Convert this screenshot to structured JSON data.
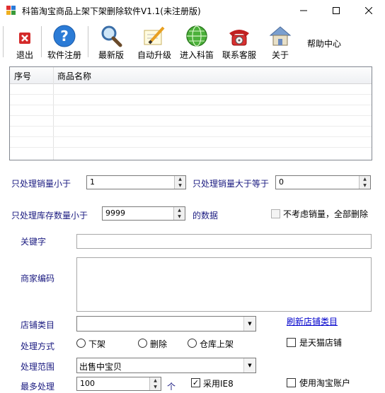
{
  "window": {
    "title": "科笛淘宝商品上架下架删除软件V1.1(未注册版)"
  },
  "toolbar": {
    "items": [
      {
        "label": "退出",
        "icon": "exit-icon"
      },
      {
        "label": "软件注册",
        "icon": "help-icon"
      },
      {
        "label": "最新版",
        "icon": "magnifier-icon"
      },
      {
        "label": "自动升级",
        "icon": "pen-icon"
      },
      {
        "label": "进入科笛",
        "icon": "globe-icon"
      },
      {
        "label": "联系客服",
        "icon": "telephone-icon"
      },
      {
        "label": "关于",
        "icon": "house-icon"
      },
      {
        "label": "帮助中心"
      }
    ]
  },
  "grid": {
    "columns": [
      "序号",
      "商品名称"
    ]
  },
  "form": {
    "sales_lt_label": "只处理销量小于",
    "sales_lt_value": "1",
    "sales_gte_label": "只处理销量大于等于",
    "sales_gte_value": "0",
    "stock_lt_label": "只处理库存数量小于",
    "stock_lt_value": "9999",
    "stock_suffix": "的数据",
    "ignore_sales_label": "不考虑销量，全部删除",
    "keyword_label": "关键字",
    "keyword_value": "",
    "merchant_code_label": "商家编码",
    "shop_category_label": "店铺类目",
    "shop_category_value": "",
    "refresh_category_link": "刷新店铺类目",
    "process_mode_label": "处理方式",
    "mode_options": [
      "下架",
      "删除",
      "仓库上架"
    ],
    "tmall_label": "是天猫店铺",
    "scope_label": "处理范围",
    "scope_value": "出售中宝贝",
    "max_label": "最多处理",
    "max_value": "100",
    "max_unit": "个",
    "use_ie8_label": "采用IE8",
    "use_ie8_checked": true,
    "use_taobao_account_label": "使用淘宝账户"
  }
}
